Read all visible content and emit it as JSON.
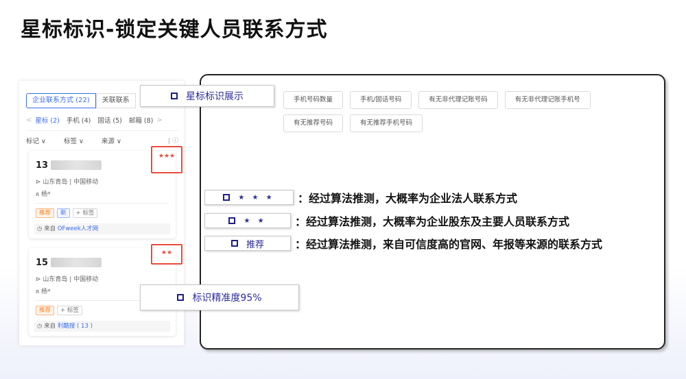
{
  "title": "星标标识-锁定关键人员联系方式",
  "left_panel": {
    "tabs": [
      "企业联系方式 (22)",
      "关联联系"
    ],
    "subtabs": {
      "prev": "<",
      "items": [
        "星标 (2)",
        "手机 (4)",
        "固话 (5)",
        "邮箱 (8)"
      ],
      "next": ">"
    },
    "filters": [
      "标记 ∨",
      "标签 ∨",
      "来源 ∨"
    ],
    "cards": [
      {
        "number_prefix": "13",
        "stars": "★★★",
        "location": "山东青岛 | 中国移动",
        "person": "杨*",
        "tags": [
          "推荐",
          "新",
          "+ 标签"
        ],
        "source_prefix": "来自 ",
        "source_link": "OFweek人才网"
      },
      {
        "number_prefix": "15",
        "stars": "★★",
        "location": "山东青岛 | 中国移动",
        "person": "杨*",
        "tags": [
          "推荐",
          "+ 标签"
        ],
        "source_prefix": "来自 ",
        "source_link": "利酷搜 ( 13 )"
      }
    ]
  },
  "callouts": {
    "star_display": "星标标识展示",
    "accuracy": "标识精准度95%"
  },
  "filter_chips": [
    "手机号码数量",
    "手机/固话号码",
    "有无非代理记账号码",
    "有无非代理记账手机号",
    "有无推荐号码",
    "有无推荐手机号码"
  ],
  "legend": [
    {
      "icon": "★ ★ ★",
      "text": "：经过算法推测，大概率为企业法人联系方式"
    },
    {
      "icon": "★ ★",
      "text": "：经过算法推测，大概率为企业股东及主要人员联系方式"
    },
    {
      "icon": "推荐",
      "text": "：经过算法推测，来自可信度高的官网、年报等来源的联系方式"
    }
  ],
  "colors": {
    "accent": "#3a6df0",
    "highlight": "#e84b3c",
    "callout_text": "#2b2b9a",
    "recommend": "#ff7d1a"
  }
}
